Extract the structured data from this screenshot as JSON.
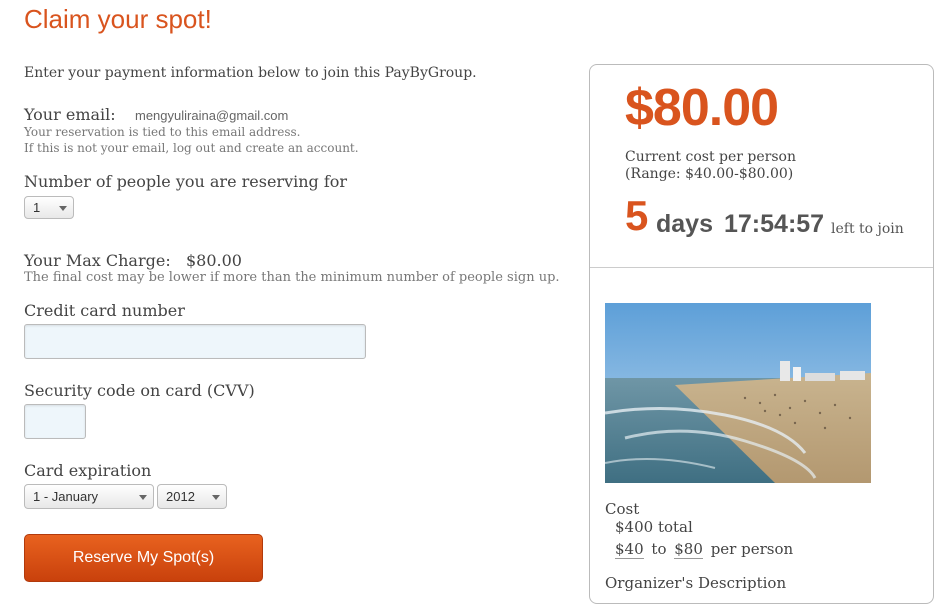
{
  "page": {
    "title": "Claim your spot!",
    "intro": "Enter your payment information below to join this PayByGroup."
  },
  "email": {
    "label": "Your email:",
    "value": "mengyuliraina@gmail.com",
    "note1": "Your reservation is tied to this email address.",
    "note2": "If this is not your email, log out and create an account."
  },
  "people": {
    "label": "Number of people you are reserving for",
    "selected": "1"
  },
  "max_charge": {
    "label": "Your Max Charge:",
    "value": "$80.00",
    "note": "The final cost may be lower if more than the minimum number of people sign up."
  },
  "card": {
    "number_label": "Credit card number",
    "number_value": "",
    "cvv_label": "Security code on card (CVV)",
    "cvv_value": "",
    "expiration_label": "Card expiration",
    "month_selected": "1 - January",
    "year_selected": "2012"
  },
  "submit": {
    "label": "Reserve My Spot(s)"
  },
  "summary": {
    "price": "$80.00",
    "cost_per_person": "Current cost per person",
    "range": "(Range: $40.00-$80.00)",
    "days": "5",
    "days_word": "days",
    "time": "17:54:57",
    "left_to_join": "left to join"
  },
  "details": {
    "cost_label": "Cost",
    "total": "$400 total",
    "min_price": "$40",
    "to": "to",
    "max_price": "$80",
    "per_person": "per person",
    "organizer_heading": "Organizer's Description"
  },
  "colors": {
    "accent": "#d9541e",
    "button": "#d9541e"
  }
}
